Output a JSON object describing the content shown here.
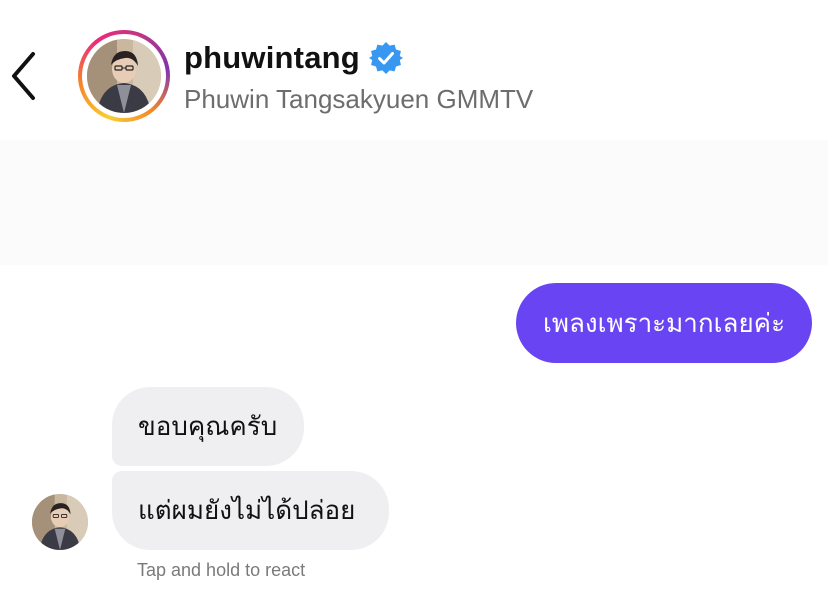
{
  "header": {
    "back_icon": "chevron-left-icon",
    "avatar_icon": "profile-photo",
    "username": "phuwintang",
    "verified_icon": "verified-badge-icon",
    "full_name": "Phuwin Tangsakyuen GMMTV"
  },
  "colors": {
    "sent_bubble": "#6944f2",
    "received_bubble": "#efeff1",
    "verified": "#3897f0",
    "story_ring": [
      "#f9ce34",
      "#ee2a7b",
      "#6228d7"
    ],
    "secondary_text": "#6d6d6d"
  },
  "messages": [
    {
      "sender": "me",
      "text": "เพลงเพราะมากเลยค่ะ"
    },
    {
      "sender": "them",
      "text": "ขอบคุณครับ"
    },
    {
      "sender": "them",
      "text": "แต่ผมยังไม่ได้ปล่อย"
    }
  ],
  "react_hint": "Tap and hold to react"
}
